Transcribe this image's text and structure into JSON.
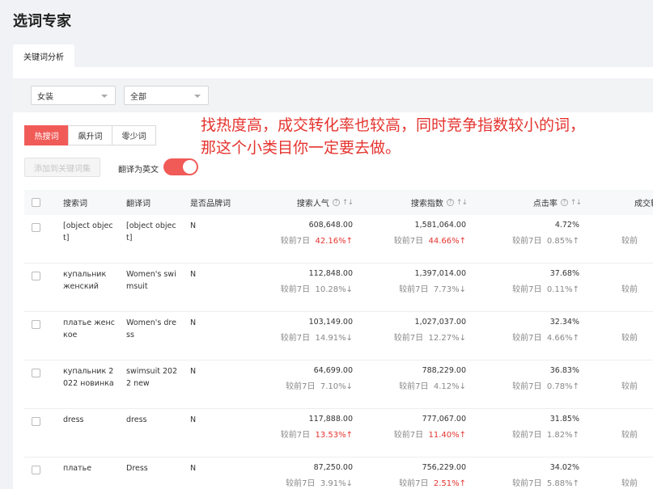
{
  "page_title": "选词专家",
  "tab_label": "关键词分析",
  "filters": {
    "category": "女装",
    "subcategory": "全部"
  },
  "segments": [
    "热搜词",
    "飙升词",
    "零少词"
  ],
  "add_button": "添加到关键词集",
  "translate_label": "翻译为英文",
  "annotation": {
    "line1": "找热度高，成交转化率也较高，同时竞争指数较小的词，",
    "line2": "那这个小类目你一定要去做。"
  },
  "columns": {
    "keyword": "搜索词",
    "translation": "翻译词",
    "brand": "是否品牌词",
    "popularity": "搜索人气",
    "index": "搜索指数",
    "ctr": "点击率",
    "conversion": "成交转"
  },
  "compare_prefix": "较前7日",
  "rows": [
    {
      "keyword": "[object object]",
      "translation": "[object object]",
      "brand": "N",
      "popularity": "608,648.00",
      "pop_change": "42.16%",
      "pop_dir": "up",
      "index": "1,581,064.00",
      "idx_change": "44.66%",
      "idx_dir": "up",
      "ctr": "4.72%",
      "ctr_change": "0.85%",
      "ctr_dir": "up",
      "cut": "较前"
    },
    {
      "keyword": "купальник женский",
      "translation": "Women's swimsuit",
      "brand": "N",
      "popularity": "112,848.00",
      "pop_change": "10.28%",
      "pop_dir": "down",
      "index": "1,397,014.00",
      "idx_change": "7.73%",
      "idx_dir": "down",
      "ctr": "37.68%",
      "ctr_change": "0.11%",
      "ctr_dir": "up",
      "cut": "较前"
    },
    {
      "keyword": "платье женское",
      "translation": "Women's dress",
      "brand": "N",
      "popularity": "103,149.00",
      "pop_change": "14.91%",
      "pop_dir": "down",
      "index": "1,027,037.00",
      "idx_change": "12.27%",
      "idx_dir": "down",
      "ctr": "32.34%",
      "ctr_change": "4.66%",
      "ctr_dir": "up",
      "cut": "较前"
    },
    {
      "keyword": "купальник 2022 новинка",
      "translation": "swimsuit 2022 new",
      "brand": "N",
      "popularity": "64,699.00",
      "pop_change": "7.10%",
      "pop_dir": "down",
      "index": "788,229.00",
      "idx_change": "4.12%",
      "idx_dir": "down",
      "ctr": "36.83%",
      "ctr_change": "0.78%",
      "ctr_dir": "up",
      "cut": "较前"
    },
    {
      "keyword": "dress",
      "translation": "dress",
      "brand": "N",
      "popularity": "117,888.00",
      "pop_change": "13.53%",
      "pop_dir": "up",
      "index": "777,067.00",
      "idx_change": "11.40%",
      "idx_dir": "up",
      "ctr": "31.85%",
      "ctr_change": "1.82%",
      "ctr_dir": "up",
      "cut": "较前"
    },
    {
      "keyword": "платье",
      "translation": "Dress",
      "brand": "N",
      "popularity": "87,250.00",
      "pop_change": "3.91%",
      "pop_dir": "down",
      "index": "756,229.00",
      "idx_change": "2.51%",
      "idx_dir": "up",
      "ctr": "34.02%",
      "ctr_change": "5.88%",
      "ctr_dir": "up",
      "cut": "较前"
    }
  ],
  "colors": {
    "accent": "#f05b58",
    "up": "#e5342f",
    "annotation": "#e5342f"
  }
}
